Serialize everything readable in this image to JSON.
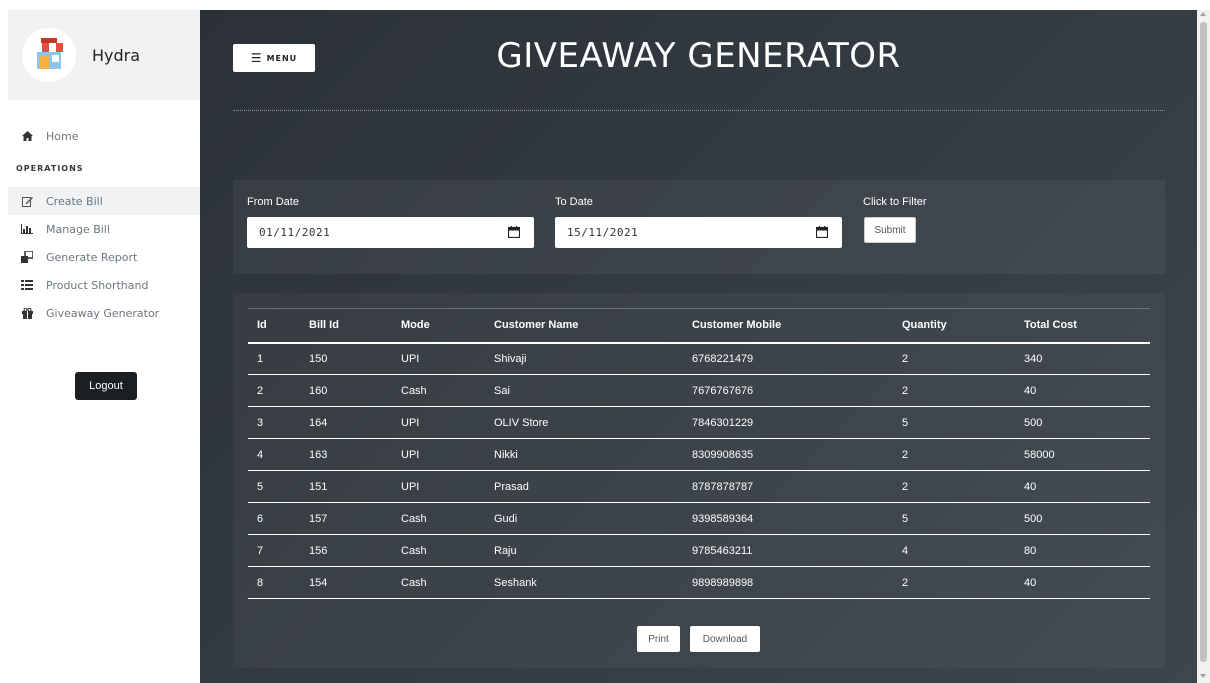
{
  "sidebar": {
    "brand": "Hydra",
    "home": "Home",
    "section": "OPERATIONS",
    "items": [
      {
        "label": "Create Bill",
        "icon": "edit-icon"
      },
      {
        "label": "Manage Bill",
        "icon": "bar-chart-icon"
      },
      {
        "label": "Generate Report",
        "icon": "copy-icon"
      },
      {
        "label": "Product Shorthand",
        "icon": "list-icon"
      },
      {
        "label": "Giveaway Generator",
        "icon": "gift-icon"
      }
    ],
    "logout": "Logout"
  },
  "header": {
    "menu": "MENU",
    "title": "GIVEAWAY GENERATOR"
  },
  "filter": {
    "from_label": "From Date",
    "from_value": "01/11/2021",
    "to_label": "To Date",
    "to_value": "15/11/2021",
    "submit_label": "Click to Filter",
    "submit": "Submit"
  },
  "table": {
    "columns": [
      "Id",
      "Bill Id",
      "Mode",
      "Customer Name",
      "Customer Mobile",
      "Quantity",
      "Total Cost"
    ],
    "rows": [
      [
        "1",
        "150",
        "UPI",
        "Shivaji",
        "6768221479",
        "2",
        "340"
      ],
      [
        "2",
        "160",
        "Cash",
        "Sai",
        "7676767676",
        "2",
        "40"
      ],
      [
        "3",
        "164",
        "UPI",
        "OLIV Store",
        "7846301229",
        "5",
        "500"
      ],
      [
        "4",
        "163",
        "UPI",
        "Nikki",
        "8309908635",
        "2",
        "58000"
      ],
      [
        "5",
        "151",
        "UPI",
        "Prasad",
        "8787878787",
        "2",
        "40"
      ],
      [
        "6",
        "157",
        "Cash",
        "Gudi",
        "9398589364",
        "5",
        "500"
      ],
      [
        "7",
        "156",
        "Cash",
        "Raju",
        "9785463211",
        "4",
        "80"
      ],
      [
        "8",
        "154",
        "Cash",
        "Seshank",
        "9898989898",
        "2",
        "40"
      ]
    ]
  },
  "actions": {
    "print": "Print",
    "download": "Download"
  }
}
